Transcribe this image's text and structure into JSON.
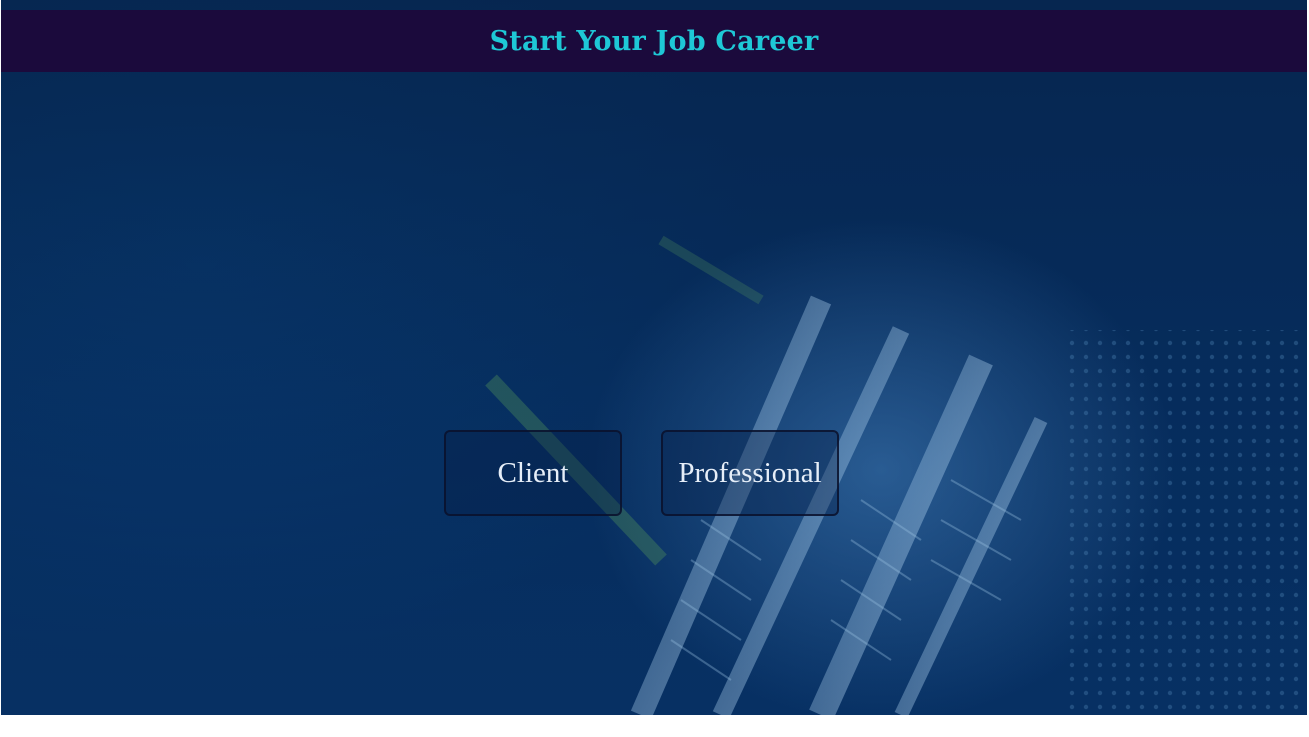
{
  "header": {
    "title": "Start Your Job Career"
  },
  "choices": {
    "client_label": "Client",
    "professional_label": "Professional"
  },
  "colors": {
    "header_bg": "#1b0a3c",
    "title_text": "#1ec8d6",
    "background": "#073468",
    "button_text": "#e6eef8"
  }
}
